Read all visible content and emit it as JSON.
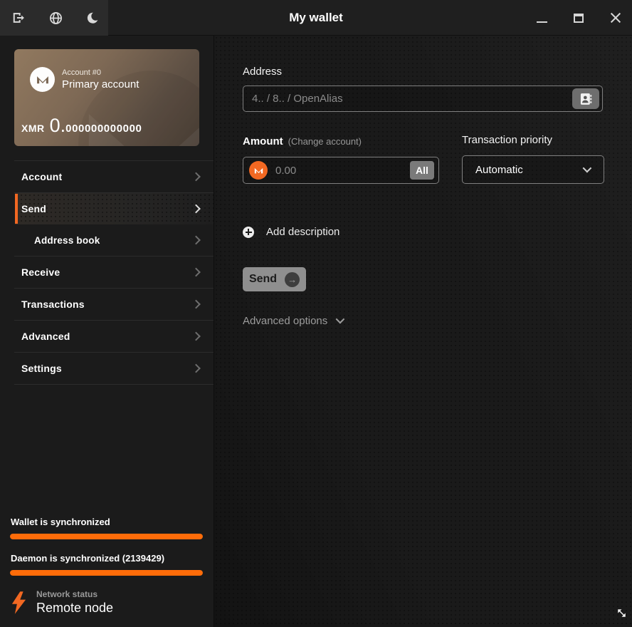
{
  "titlebar": {
    "title": "My wallet",
    "icons": [
      "logout-icon",
      "globe-icon",
      "moon-icon"
    ],
    "window_controls": [
      "minimize-icon",
      "maximize-icon",
      "close-icon"
    ]
  },
  "account_card": {
    "account_index_label": "Account #0",
    "account_name": "Primary account",
    "currency": "XMR",
    "balance_whole": "0.",
    "balance_fraction": "000000000000"
  },
  "sidebar": {
    "items": [
      {
        "label": "Account",
        "active": false,
        "sub": false
      },
      {
        "label": "Send",
        "active": true,
        "sub": false
      },
      {
        "label": "Address book",
        "active": false,
        "sub": true
      },
      {
        "label": "Receive",
        "active": false,
        "sub": false
      },
      {
        "label": "Transactions",
        "active": false,
        "sub": false
      },
      {
        "label": "Advanced",
        "active": false,
        "sub": false
      },
      {
        "label": "Settings",
        "active": false,
        "sub": false
      }
    ]
  },
  "send_form": {
    "address_label": "Address",
    "address_placeholder": "4.. / 8.. / OpenAlias",
    "amount_label": "Amount",
    "change_account_label": "(Change account)",
    "amount_placeholder": "0.00",
    "all_button_label": "All",
    "priority_label": "Transaction priority",
    "priority_value": "Automatic",
    "add_description_label": "Add description",
    "send_button_label": "Send",
    "send_arrow_glyph": "→",
    "advanced_options_label": "Advanced options"
  },
  "status": {
    "wallet_sync_label": "Wallet is synchronized",
    "wallet_sync_progress": 100,
    "daemon_sync_label": "Daemon is synchronized (2139429)",
    "daemon_block_height": "2139429",
    "daemon_sync_progress": 100,
    "network_status_label": "Network status",
    "network_status_value": "Remote node"
  },
  "colors": {
    "accent_orange": "#f26822",
    "progress_orange": "#ff6c09",
    "card_brown_light": "#91795f",
    "card_brown_dark": "#4c4037",
    "sidebar_bg": "#1b1b1b",
    "main_bg": "#1a1a1a",
    "titlebar_bg": "#1f1f1f"
  }
}
